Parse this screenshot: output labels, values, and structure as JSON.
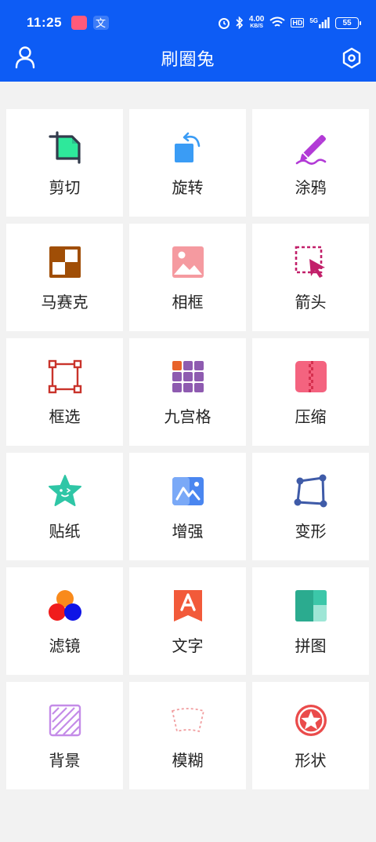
{
  "status_bar": {
    "time": "11:25",
    "net_speed_value": "4.00",
    "net_speed_unit": "KB/S",
    "hd": "HD",
    "network": "5G",
    "battery": "55"
  },
  "toolbar": {
    "title": "刷圈兔"
  },
  "colors": {
    "appbar": "#0d5cf5",
    "background": "#f2f2f2"
  },
  "tools": [
    {
      "label": "剪切",
      "icon": "crop-icon"
    },
    {
      "label": "旋转",
      "icon": "rotate-icon"
    },
    {
      "label": "涂鸦",
      "icon": "doodle-pen-icon"
    },
    {
      "label": "马赛克",
      "icon": "mosaic-icon"
    },
    {
      "label": "相框",
      "icon": "photo-frame-icon"
    },
    {
      "label": "箭头",
      "icon": "arrow-cursor-icon"
    },
    {
      "label": "框选",
      "icon": "box-select-icon"
    },
    {
      "label": "九宫格",
      "icon": "nine-grid-icon"
    },
    {
      "label": "压缩",
      "icon": "compress-zip-icon"
    },
    {
      "label": "贴纸",
      "icon": "star-sticker-icon"
    },
    {
      "label": "增强",
      "icon": "enhance-image-icon"
    },
    {
      "label": "变形",
      "icon": "transform-quad-icon"
    },
    {
      "label": "滤镜",
      "icon": "filter-circles-icon"
    },
    {
      "label": "文字",
      "icon": "text-bookmark-icon"
    },
    {
      "label": "拼图",
      "icon": "collage-icon"
    },
    {
      "label": "背景",
      "icon": "background-pattern-icon"
    },
    {
      "label": "模糊",
      "icon": "blur-icon"
    },
    {
      "label": "形状",
      "icon": "shape-star-circle-icon"
    }
  ]
}
